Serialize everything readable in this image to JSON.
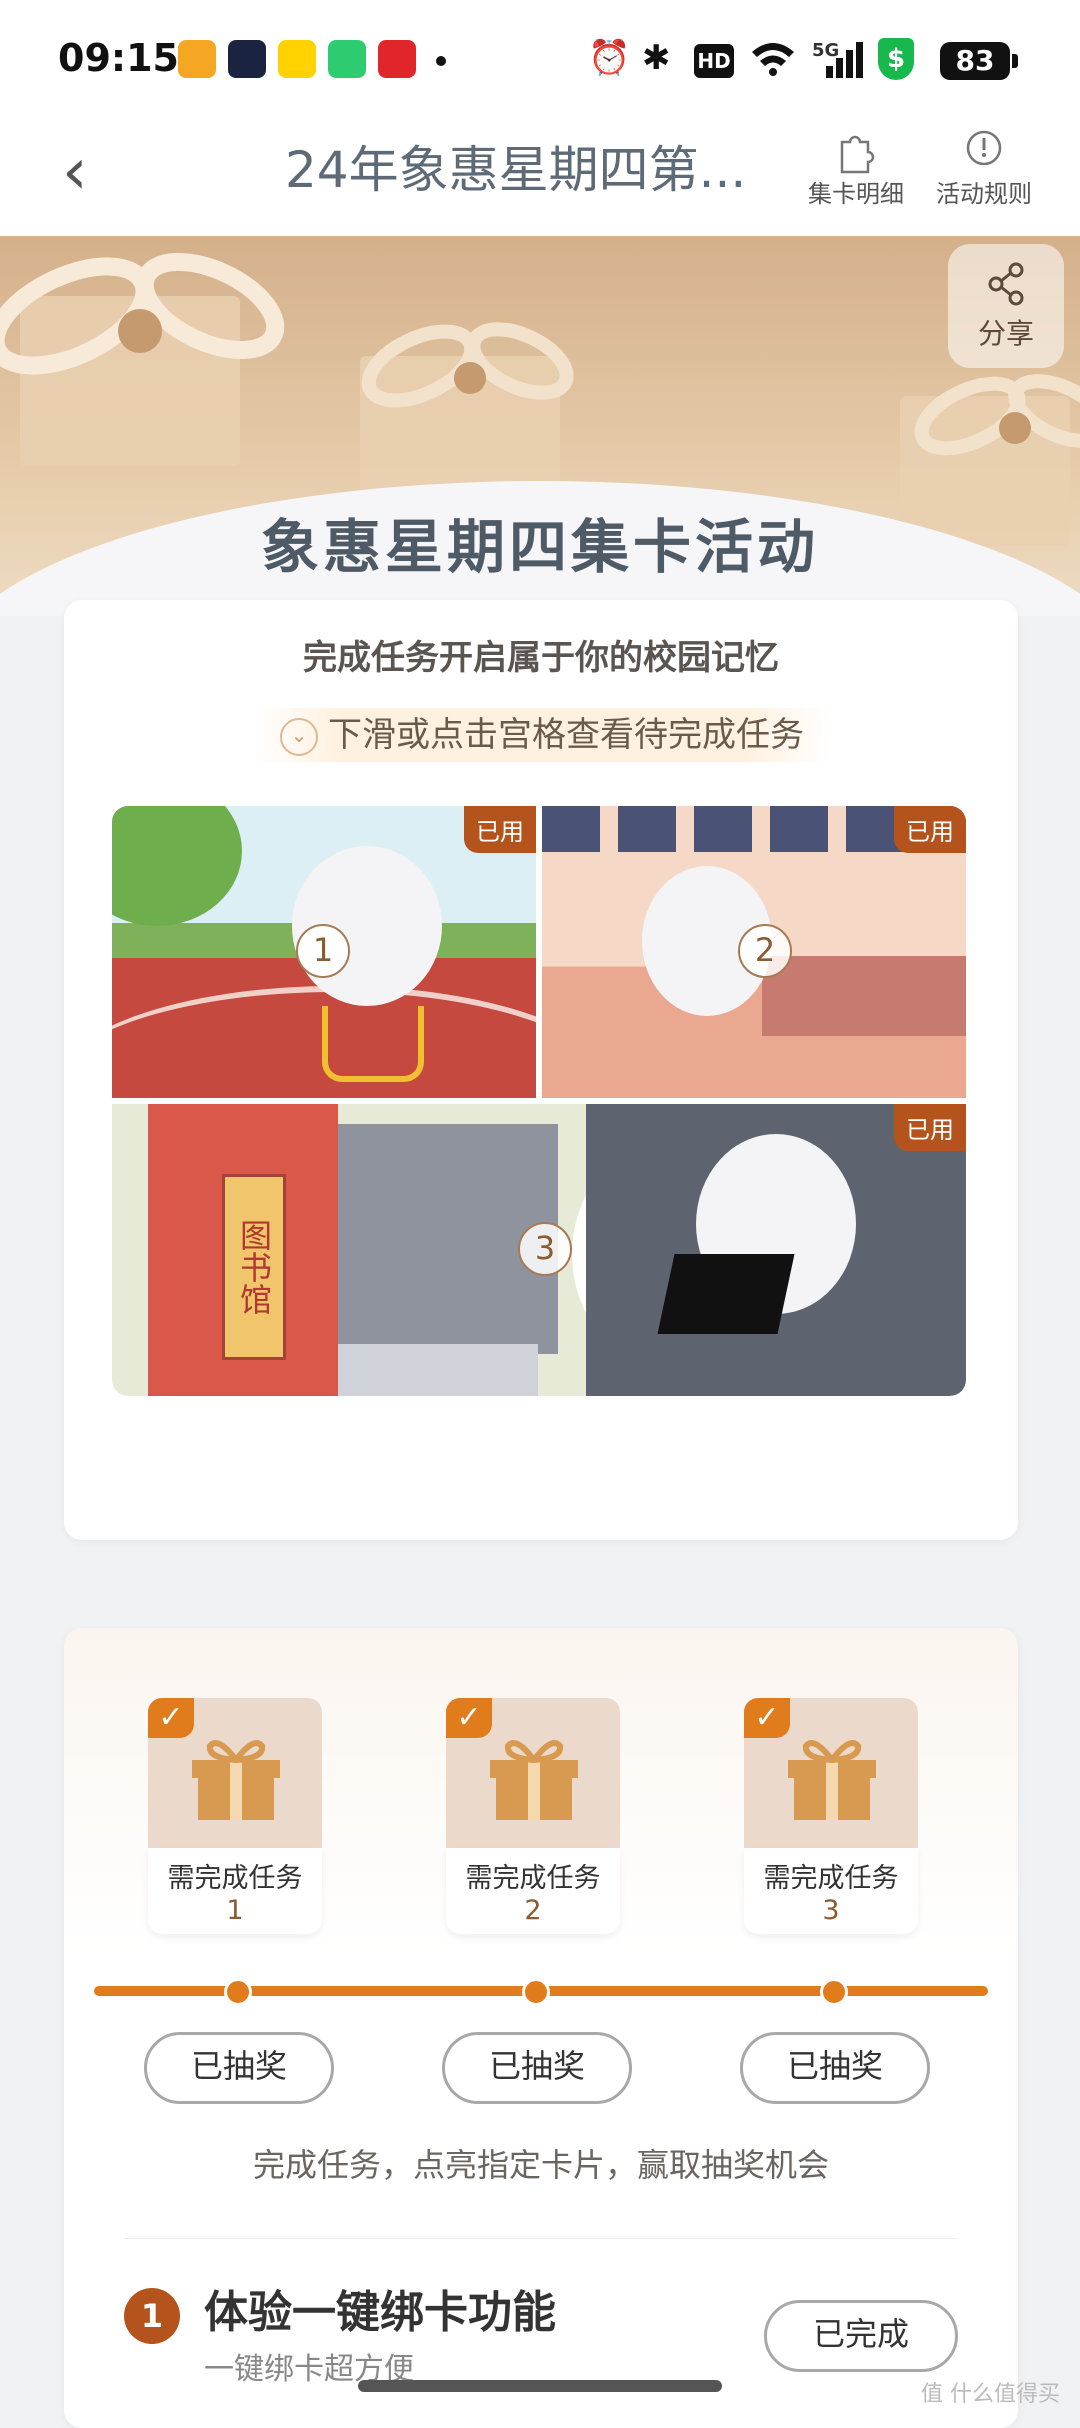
{
  "status_bar": {
    "time": "09:15",
    "battery": "83",
    "network": "5G"
  },
  "nav": {
    "title": "24年象惠星期四第...",
    "card_detail": "集卡明细",
    "rules": "活动规则"
  },
  "share": {
    "label": "分享"
  },
  "hero": {
    "title": "象惠星期四集卡活动"
  },
  "card1": {
    "subtitle": "完成任务开启属于你的校园记忆",
    "hint": "下滑或点击宫格查看待完成任务",
    "tiles": [
      {
        "num": "1",
        "tag": "已用"
      },
      {
        "num": "2",
        "tag": "已用"
      },
      {
        "num": "3",
        "tag": "已用",
        "library": "图书馆"
      }
    ]
  },
  "rewards": [
    {
      "line1": "需完成任务",
      "line2": "1",
      "button": "已抽奖"
    },
    {
      "line1": "需完成任务",
      "line2": "2",
      "button": "已抽奖"
    },
    {
      "line1": "需完成任务",
      "line2": "3",
      "button": "已抽奖"
    }
  ],
  "card2": {
    "hint": "完成任务，点亮指定卡片，赢取抽奖机会",
    "task": {
      "num": "1",
      "title": "体验一键绑卡功能",
      "subtitle": "一键绑卡超方便",
      "button": "已完成"
    }
  },
  "watermark": "值 什么值得买",
  "colors": {
    "accent": "#e17c1c",
    "tag": "#b4541c",
    "hero": "#d4b08a"
  }
}
